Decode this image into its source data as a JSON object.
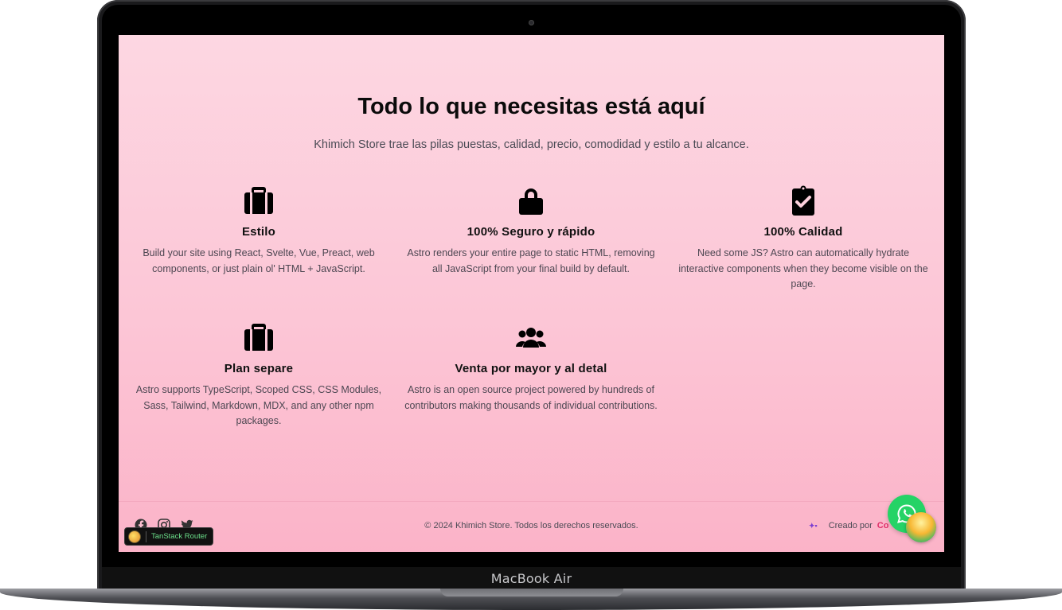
{
  "device": {
    "model_label": "MacBook Air"
  },
  "hero": {
    "title": "Todo lo que necesitas está aquí",
    "subtitle": "Khimich Store trae las pilas puestas, calidad, precio, comodidad y estilo a tu alcance."
  },
  "features": [
    {
      "icon": "briefcase-icon",
      "title": "Estilo",
      "description": "Build your site using React, Svelte, Vue, Preact, web components, or just plain ol' HTML + JavaScript."
    },
    {
      "icon": "lock-icon",
      "title": "100% Seguro y rápido",
      "description": "Astro renders your entire page to static HTML, removing all JavaScript from your final build by default."
    },
    {
      "icon": "clipboard-check-icon",
      "title": "100% Calidad",
      "description": "Need some JS? Astro can automatically hydrate interactive components when they become visible on the page."
    },
    {
      "icon": "briefcase-icon",
      "title": "Plan separe",
      "description": "Astro supports TypeScript, Scoped CSS, CSS Modules, Sass, Tailwind, Markdown, MDX, and any other npm packages."
    },
    {
      "icon": "users-icon",
      "title": "Venta por mayor y al detal",
      "description": "Astro is an open source project powered by hundreds of contributors making thousands of individual contributions."
    }
  ],
  "footer": {
    "social_icons": [
      "facebook-icon",
      "instagram-icon",
      "twitter-icon"
    ],
    "copyright": "© 2024 Khimich Store. Todos los derechos reservados.",
    "credit_prefix": "Creado por",
    "credit_brand": "Co"
  },
  "devtools": {
    "label": "TanStack Router"
  },
  "colors": {
    "background_top": "#fdd7e2",
    "background_bottom": "#fbb3c8",
    "whatsapp": "#25d366",
    "brand_accent": "#e0316b"
  }
}
